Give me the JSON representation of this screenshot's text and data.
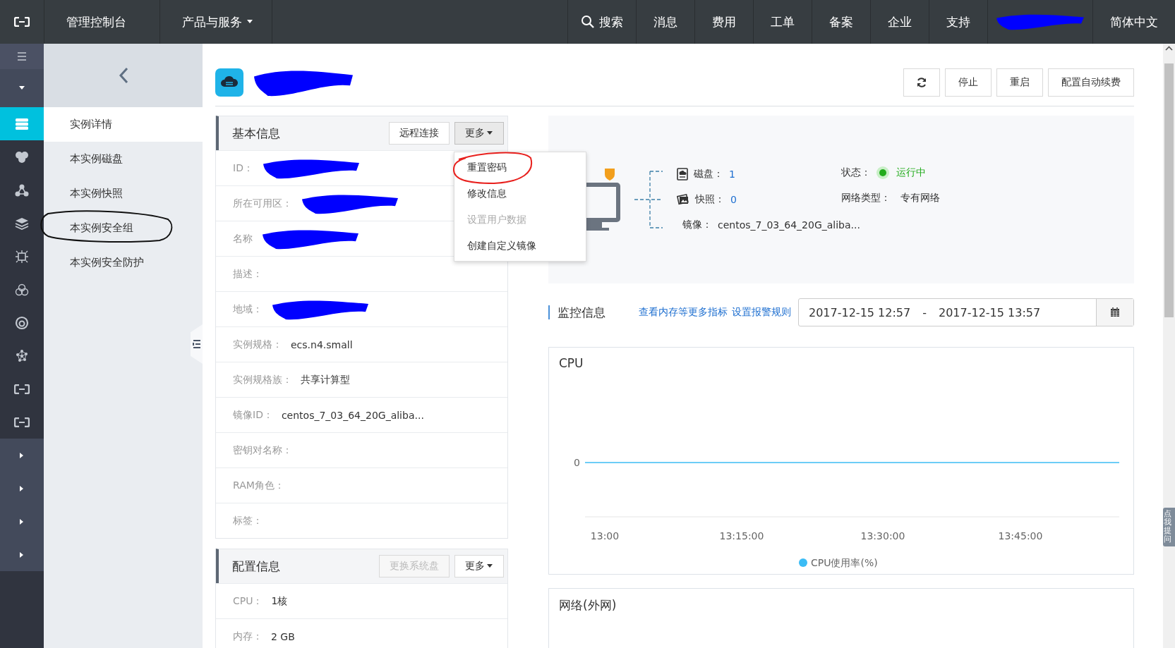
{
  "top_bar": {
    "left_menu": [
      {
        "kind": "link",
        "label": "管理控制台"
      },
      {
        "kind": "dropdown",
        "label": "产品与服务"
      }
    ],
    "right_menu": [
      {
        "kind": "search",
        "label": "搜索"
      },
      {
        "kind": "link",
        "label": "消息"
      },
      {
        "kind": "link",
        "label": "费用"
      },
      {
        "kind": "link",
        "label": "工单"
      },
      {
        "kind": "link",
        "label": "备案"
      },
      {
        "kind": "link",
        "label": "企业"
      },
      {
        "kind": "link",
        "label": "支持"
      },
      {
        "kind": "redacted"
      },
      {
        "kind": "link",
        "label": "简体中文"
      }
    ]
  },
  "icon_rail": {
    "items": [
      {
        "kind": "menu",
        "selected": false
      },
      {
        "kind": "collapse",
        "selected": false
      },
      {
        "kind": "server",
        "selected": true
      },
      {
        "kind": "blobs",
        "selected": false
      },
      {
        "kind": "nodes",
        "selected": false
      },
      {
        "kind": "layers",
        "selected": false
      },
      {
        "kind": "chip",
        "selected": false
      },
      {
        "kind": "circles",
        "selected": false
      },
      {
        "kind": "ring",
        "selected": false
      },
      {
        "kind": "network",
        "selected": false
      },
      {
        "kind": "logo",
        "selected": false
      },
      {
        "kind": "logo",
        "selected": false
      },
      {
        "kind": "expand",
        "selected": false
      },
      {
        "kind": "expand",
        "selected": false
      },
      {
        "kind": "expand",
        "selected": false
      },
      {
        "kind": "expand",
        "selected": false
      }
    ]
  },
  "sub_nav": {
    "items": [
      {
        "label": "实例详情",
        "selected": true,
        "circled": false
      },
      {
        "label": "本实例磁盘",
        "selected": false,
        "circled": false
      },
      {
        "label": "本实例快照",
        "selected": false,
        "circled": false
      },
      {
        "label": "本实例安全组",
        "selected": false,
        "circled": true
      },
      {
        "label": "本实例安全防护",
        "selected": false,
        "circled": false
      }
    ]
  },
  "page_header": {
    "title_redacted": true,
    "buttons": [
      {
        "kind": "refresh"
      },
      {
        "kind": "text",
        "label": "停止"
      },
      {
        "kind": "text",
        "label": "重启"
      },
      {
        "kind": "text",
        "label": "配置自动续费"
      }
    ]
  },
  "basic_info": {
    "title": "基本信息",
    "actions": [
      {
        "kind": "button",
        "label": "远程连接",
        "disabled": false,
        "expanded": false
      },
      {
        "kind": "dropdown",
        "label": "更多",
        "disabled": false,
        "expanded": true
      }
    ],
    "menu": [
      {
        "label": "重置密码",
        "disabled": false,
        "circled": true
      },
      {
        "label": "修改信息",
        "disabled": false,
        "circled": false
      },
      {
        "label": "设置用户数据",
        "disabled": true,
        "circled": false
      },
      {
        "label": "创建自定义镜像",
        "disabled": false,
        "circled": false
      }
    ],
    "rows": [
      {
        "label": "ID：",
        "redacted": true
      },
      {
        "label": "所在可用区：",
        "redacted": true
      },
      {
        "label": "名称",
        "redacted": true
      },
      {
        "label": "描述：",
        "redacted": false
      },
      {
        "label": "地域：",
        "redacted": true
      },
      {
        "label": "实例规格：",
        "value": "ecs.n4.small",
        "redacted": false
      },
      {
        "label": "实例规格族：",
        "value": "共享计算型",
        "redacted": false
      },
      {
        "label": "镜像ID：",
        "value": "centos_7_03_64_20G_aliba...",
        "redacted": false
      },
      {
        "label": "密钥对名称：",
        "redacted": false
      },
      {
        "label": "RAM角色：",
        "redacted": false
      },
      {
        "label": "标签：",
        "redacted": false
      }
    ]
  },
  "config_info": {
    "title": "配置信息",
    "actions": [
      {
        "kind": "button",
        "label": "更换系统盘",
        "disabled": true,
        "expanded": false
      },
      {
        "kind": "dropdown",
        "label": "更多",
        "disabled": false,
        "expanded": false
      }
    ],
    "rows": [
      {
        "label": "CPU：",
        "value": "1核",
        "redacted": false
      },
      {
        "label": "内存：",
        "value": "2 GB",
        "redacted": false
      }
    ]
  },
  "overview": {
    "resources": [
      {
        "kind": "disk",
        "label": "磁盘：",
        "value": "1",
        "link": true
      },
      {
        "kind": "snapshot",
        "label": "快照：",
        "value": "0",
        "link": true
      },
      {
        "kind": "image",
        "label": "镜像：",
        "value": "centos_7_03_64_20G_aliba...",
        "link": false
      }
    ],
    "status": {
      "label": "状态：",
      "value": "运行中",
      "color": "#22ab1c"
    },
    "network": {
      "label": "网络类型：",
      "value": "专有网络"
    }
  },
  "monitor": {
    "title": "监控信息",
    "links": [
      "查看内存等更多指标",
      "设置报警规则"
    ],
    "range": {
      "start": "2017-12-15 12:57",
      "separator": "-",
      "end": "2017-12-15 13:57"
    }
  },
  "cpu_chart": {
    "title": "CPU",
    "y_label": "0",
    "x_labels": [
      "13:00",
      "13:15:00",
      "13:30:00",
      "13:45:00"
    ],
    "legend": [
      {
        "name": "CPU使用率(%)",
        "color": "#3bbcf5"
      }
    ]
  },
  "network_chart": {
    "title": "网络(外网)"
  },
  "help_tab": {
    "label": "点我提问"
  }
}
